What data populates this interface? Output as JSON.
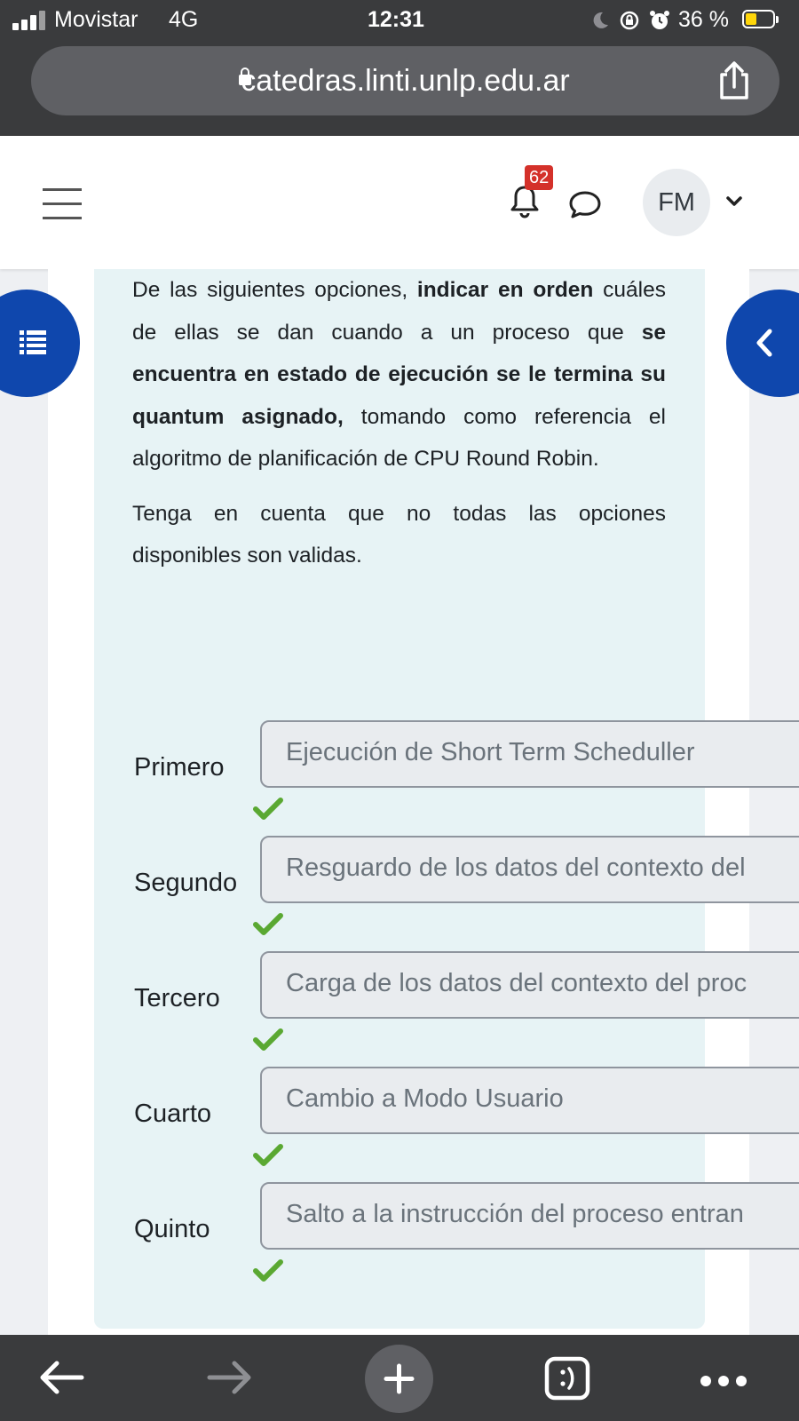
{
  "status_bar": {
    "carrier": "Movistar",
    "network": "4G",
    "time": "12:31",
    "battery": "36 %",
    "battery_color": "#ffd60a"
  },
  "browser": {
    "url": "catedras.linti.unlp.edu.ar",
    "icons": [
      "lock-icon",
      "share-icon"
    ]
  },
  "header": {
    "notifications_count": "62",
    "avatar_initials": "FM",
    "icons": [
      "menu-icon",
      "bell-icon",
      "chat-icon",
      "chevron-down-icon"
    ]
  },
  "question": {
    "p1_a": "De las siguientes opciones, ",
    "p1_b": "indicar en orden",
    "p1_c": " cuáles de ellas se dan cuando a un proceso que ",
    "p1_d": "se encuentra en estado de ejecución se le termina su quantum asignado,",
    "p1_e": " tomando como referencia el algoritmo de planificación de CPU Round Robin.",
    "p2": "Tenga en cuenta que no todas las opciones disponibles son validas."
  },
  "answers": [
    {
      "label": "Primero",
      "value": "Ejecución de Short Term Scheduller",
      "correct": true
    },
    {
      "label": "Segundo",
      "value": "Resguardo de los datos del contexto del",
      "correct": true
    },
    {
      "label": "Tercero",
      "value": "Carga de los datos del contexto del proc",
      "correct": true
    },
    {
      "label": "Cuarto",
      "value": "Cambio a Modo Usuario",
      "correct": true
    },
    {
      "label": "Quinto",
      "value": "Salto a la instrucción del proceso entran",
      "correct": true
    }
  ],
  "colors": {
    "accent": "#0f47ad",
    "panel": "#e7f3f5",
    "check": "#5aa832",
    "badge": "#d4312a"
  }
}
